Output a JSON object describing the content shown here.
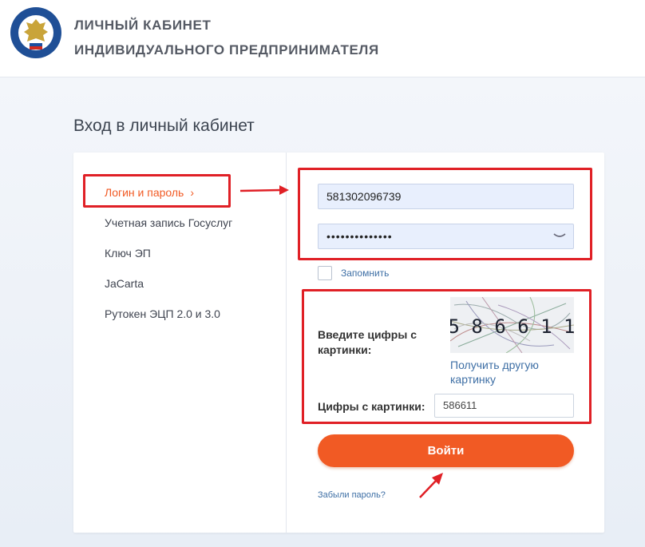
{
  "header": {
    "line1": "ЛИЧНЫЙ КАБИНЕТ",
    "line2": "ИНДИВИДУАЛЬНОГО ПРЕДПРИНИМАТЕЛЯ",
    "logo_icon": "fns-emblem-icon"
  },
  "page": {
    "title": "Вход в личный кабинет"
  },
  "auth_methods": [
    {
      "label": "Логин и пароль",
      "active": true
    },
    {
      "label": "Учетная запись Госуслуг",
      "active": false
    },
    {
      "label": "Ключ ЭП",
      "active": false
    },
    {
      "label": "JaCarta",
      "active": false
    },
    {
      "label": "Рутокен ЭЦП 2.0 и 3.0",
      "active": false
    }
  ],
  "form": {
    "login_value": "581302096739",
    "password_value": "••••••••••••••",
    "remember_label": "Запомнить",
    "captcha_prompt": "Введите цифры с картинки:",
    "captcha_digits": "5 8 6 6 1 1",
    "captcha_refresh_link": "Получить другую картинку",
    "digits_label": "Цифры с картинки:",
    "digits_value": "586611",
    "submit_label": "Войти",
    "forgot_link": "Забыли пароль?"
  },
  "colors": {
    "accent": "#f15a24",
    "link": "#3e6fa5",
    "annotation_red": "#e02026"
  }
}
